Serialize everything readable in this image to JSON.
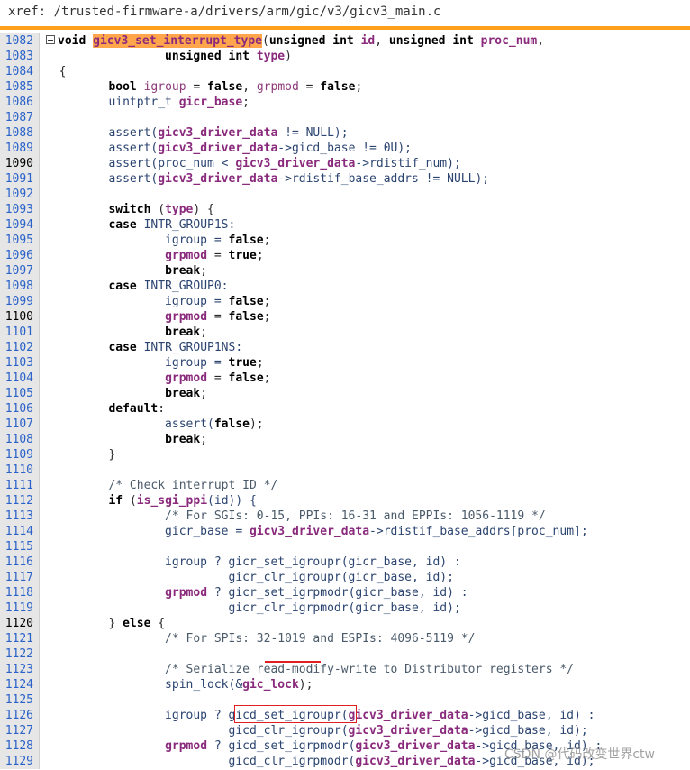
{
  "xref": {
    "path": "xref: /trusted-firmware-a/drivers/arm/gic/v3/gicv3_main.c"
  },
  "watermark": "CSDN @代码改变世界ctw",
  "colors": {
    "accent_bar": "#ff9f1a",
    "highlight": "#ffa64d",
    "annotation_red": "#e02020",
    "gutter": "#e6e6e6",
    "line_number": "#2a62c9"
  },
  "current_lines": [
    "1090",
    "1100",
    "1120"
  ],
  "lines": [
    {
      "num": "1082",
      "segs": [
        {
          "t": "void ",
          "c": "kw"
        },
        {
          "t": "gicv3_set_interrupt_type",
          "c": "hl"
        },
        {
          "t": "(",
          "c": "p"
        },
        {
          "t": "unsigned int ",
          "c": "kw"
        },
        {
          "t": "id",
          "c": "idb"
        },
        {
          "t": ", ",
          "c": "p"
        },
        {
          "t": "unsigned int ",
          "c": "kw"
        },
        {
          "t": "proc_num",
          "c": "idb"
        },
        {
          "t": ",",
          "c": "p"
        }
      ]
    },
    {
      "num": "1083",
      "segs": [
        {
          "t": "                 unsigned int ",
          "c": "kw"
        },
        {
          "t": "type",
          "c": "idb"
        },
        {
          "t": ")",
          "c": "p"
        }
      ]
    },
    {
      "num": "1084",
      "segs": [
        {
          "t": "  {",
          "c": "p"
        }
      ]
    },
    {
      "num": "1085",
      "segs": [
        {
          "t": "         ",
          "c": "p"
        },
        {
          "t": "bool ",
          "c": "kw"
        },
        {
          "t": "igroup",
          "c": "id"
        },
        {
          "t": " = ",
          "c": "p"
        },
        {
          "t": "false",
          "c": "kw"
        },
        {
          "t": ", ",
          "c": "p"
        },
        {
          "t": "grpmod",
          "c": "id"
        },
        {
          "t": " = ",
          "c": "p"
        },
        {
          "t": "false",
          "c": "kw"
        },
        {
          "t": ";",
          "c": "p"
        }
      ]
    },
    {
      "num": "1086",
      "segs": [
        {
          "t": "         uintptr_t ",
          "c": "plain"
        },
        {
          "t": "gicr_base",
          "c": "idb"
        },
        {
          "t": ";",
          "c": "p"
        }
      ]
    },
    {
      "num": "1087",
      "segs": []
    },
    {
      "num": "1088",
      "segs": [
        {
          "t": "         assert(",
          "c": "plain"
        },
        {
          "t": "gicv3_driver_data",
          "c": "idb"
        },
        {
          "t": " != NULL);",
          "c": "plain"
        }
      ]
    },
    {
      "num": "1089",
      "segs": [
        {
          "t": "         assert(",
          "c": "plain"
        },
        {
          "t": "gicv3_driver_data",
          "c": "idb"
        },
        {
          "t": "->gicd_base != 0U);",
          "c": "plain"
        }
      ]
    },
    {
      "num": "1090",
      "segs": [
        {
          "t": "         assert(proc_num < ",
          "c": "plain"
        },
        {
          "t": "gicv3_driver_data",
          "c": "idb"
        },
        {
          "t": "->rdistif_num);",
          "c": "plain"
        }
      ]
    },
    {
      "num": "1091",
      "segs": [
        {
          "t": "         assert(",
          "c": "plain"
        },
        {
          "t": "gicv3_driver_data",
          "c": "idb"
        },
        {
          "t": "->rdistif_base_addrs != NULL);",
          "c": "plain"
        }
      ]
    },
    {
      "num": "1092",
      "segs": []
    },
    {
      "num": "1093",
      "segs": [
        {
          "t": "         ",
          "c": "p"
        },
        {
          "t": "switch",
          "c": "kw"
        },
        {
          "t": " (",
          "c": "p"
        },
        {
          "t": "type",
          "c": "idb"
        },
        {
          "t": ") {",
          "c": "p"
        }
      ]
    },
    {
      "num": "1094",
      "segs": [
        {
          "t": "         ",
          "c": "p"
        },
        {
          "t": "case",
          "c": "kw"
        },
        {
          "t": " INTR_GROUP1S:",
          "c": "plain"
        }
      ]
    },
    {
      "num": "1095",
      "segs": [
        {
          "t": "                 igroup = ",
          "c": "plain"
        },
        {
          "t": "false",
          "c": "kw"
        },
        {
          "t": ";",
          "c": "p"
        }
      ]
    },
    {
      "num": "1096",
      "segs": [
        {
          "t": "                 ",
          "c": "p"
        },
        {
          "t": "grpmod",
          "c": "idb"
        },
        {
          "t": " = ",
          "c": "p"
        },
        {
          "t": "true",
          "c": "kw"
        },
        {
          "t": ";",
          "c": "p"
        }
      ]
    },
    {
      "num": "1097",
      "segs": [
        {
          "t": "                 ",
          "c": "p"
        },
        {
          "t": "break",
          "c": "kw"
        },
        {
          "t": ";",
          "c": "p"
        }
      ]
    },
    {
      "num": "1098",
      "segs": [
        {
          "t": "         ",
          "c": "p"
        },
        {
          "t": "case",
          "c": "kw"
        },
        {
          "t": " INTR_GROUP0:",
          "c": "plain"
        }
      ]
    },
    {
      "num": "1099",
      "segs": [
        {
          "t": "                 igroup = ",
          "c": "plain"
        },
        {
          "t": "false",
          "c": "kw"
        },
        {
          "t": ";",
          "c": "p"
        }
      ]
    },
    {
      "num": "1100",
      "segs": [
        {
          "t": "                 ",
          "c": "p"
        },
        {
          "t": "grpmod",
          "c": "idb"
        },
        {
          "t": " = ",
          "c": "p"
        },
        {
          "t": "false",
          "c": "kw"
        },
        {
          "t": ";",
          "c": "p"
        }
      ]
    },
    {
      "num": "1101",
      "segs": [
        {
          "t": "                 ",
          "c": "p"
        },
        {
          "t": "break",
          "c": "kw"
        },
        {
          "t": ";",
          "c": "p"
        }
      ]
    },
    {
      "num": "1102",
      "segs": [
        {
          "t": "         ",
          "c": "p"
        },
        {
          "t": "case",
          "c": "kw"
        },
        {
          "t": " INTR_GROUP1NS:",
          "c": "plain"
        }
      ]
    },
    {
      "num": "1103",
      "segs": [
        {
          "t": "                 igroup = ",
          "c": "plain"
        },
        {
          "t": "true",
          "c": "kw"
        },
        {
          "t": ";",
          "c": "p"
        }
      ]
    },
    {
      "num": "1104",
      "segs": [
        {
          "t": "                 ",
          "c": "p"
        },
        {
          "t": "grpmod",
          "c": "idb"
        },
        {
          "t": " = ",
          "c": "p"
        },
        {
          "t": "false",
          "c": "kw"
        },
        {
          "t": ";",
          "c": "p"
        }
      ]
    },
    {
      "num": "1105",
      "segs": [
        {
          "t": "                 ",
          "c": "p"
        },
        {
          "t": "break",
          "c": "kw"
        },
        {
          "t": ";",
          "c": "p"
        }
      ]
    },
    {
      "num": "1106",
      "segs": [
        {
          "t": "         ",
          "c": "p"
        },
        {
          "t": "default",
          "c": "kw"
        },
        {
          "t": ":",
          "c": "p"
        }
      ]
    },
    {
      "num": "1107",
      "segs": [
        {
          "t": "                 assert(",
          "c": "plain"
        },
        {
          "t": "false",
          "c": "kw"
        },
        {
          "t": ");",
          "c": "p"
        }
      ]
    },
    {
      "num": "1108",
      "segs": [
        {
          "t": "                 ",
          "c": "p"
        },
        {
          "t": "break",
          "c": "kw"
        },
        {
          "t": ";",
          "c": "p"
        }
      ]
    },
    {
      "num": "1109",
      "segs": [
        {
          "t": "         }",
          "c": "p"
        }
      ]
    },
    {
      "num": "1110",
      "segs": []
    },
    {
      "num": "1111",
      "segs": [
        {
          "t": "         /* Check interrupt ID */",
          "c": "cm"
        }
      ]
    },
    {
      "num": "1112",
      "segs": [
        {
          "t": "         ",
          "c": "p"
        },
        {
          "t": "if",
          "c": "kw"
        },
        {
          "t": " (",
          "c": "p"
        },
        {
          "t": "is_sgi_ppi",
          "c": "idb"
        },
        {
          "t": "(id)) {",
          "c": "plain"
        }
      ]
    },
    {
      "num": "1113",
      "segs": [
        {
          "t": "                 /* For SGIs: 0-15, PPIs: 16-31 and EPPIs: 1056-1119 */",
          "c": "cm"
        }
      ]
    },
    {
      "num": "1114",
      "segs": [
        {
          "t": "                 gicr_base = ",
          "c": "plain"
        },
        {
          "t": "gicv3_driver_data",
          "c": "idb"
        },
        {
          "t": "->rdistif_base_addrs[proc_num];",
          "c": "plain"
        }
      ]
    },
    {
      "num": "1115",
      "segs": []
    },
    {
      "num": "1116",
      "segs": [
        {
          "t": "                 igroup ? gicr_set_igroupr(gicr_base, id) :",
          "c": "plain"
        }
      ]
    },
    {
      "num": "1117",
      "segs": [
        {
          "t": "                          gicr_clr_igroupr(gicr_base, id);",
          "c": "plain"
        }
      ]
    },
    {
      "num": "1118",
      "segs": [
        {
          "t": "                 ",
          "c": "p"
        },
        {
          "t": "grpmod",
          "c": "idb"
        },
        {
          "t": " ? gicr_set_igrpmodr(gicr_base, id) :",
          "c": "plain"
        }
      ]
    },
    {
      "num": "1119",
      "segs": [
        {
          "t": "                          gicr_clr_igrpmodr(gicr_base, id);",
          "c": "plain"
        }
      ]
    },
    {
      "num": "1120",
      "segs": [
        {
          "t": "         } ",
          "c": "p"
        },
        {
          "t": "else",
          "c": "kw"
        },
        {
          "t": " {",
          "c": "p"
        }
      ]
    },
    {
      "num": "1121",
      "segs": [
        {
          "t": "                 /* For SPIs: 32-1019 and ESPIs: 4096-5119 */",
          "c": "cm"
        }
      ]
    },
    {
      "num": "1122",
      "segs": []
    },
    {
      "num": "1123",
      "segs": [
        {
          "t": "                 /* Serialize read-modify-write to Distributor registers */",
          "c": "cm"
        }
      ]
    },
    {
      "num": "1124",
      "segs": [
        {
          "t": "                 spin_lock(&",
          "c": "plain"
        },
        {
          "t": "gic_lock",
          "c": "idb"
        },
        {
          "t": ");",
          "c": "p"
        }
      ]
    },
    {
      "num": "1125",
      "segs": []
    },
    {
      "num": "1126",
      "segs": [
        {
          "t": "                 igroup ? gicd_set_igroupr(",
          "c": "plain"
        },
        {
          "t": "gicv3_driver_data",
          "c": "idb"
        },
        {
          "t": "->gicd_base, id) :",
          "c": "plain"
        }
      ]
    },
    {
      "num": "1127",
      "segs": [
        {
          "t": "                          gicd_clr_igroupr(",
          "c": "plain"
        },
        {
          "t": "gicv3_driver_data",
          "c": "idb"
        },
        {
          "t": "->gicd_base, id);",
          "c": "plain"
        }
      ]
    },
    {
      "num": "1128",
      "segs": [
        {
          "t": "                 ",
          "c": "p"
        },
        {
          "t": "grpmod",
          "c": "idb"
        },
        {
          "t": " ? gicd_set_igrpmodr(",
          "c": "plain"
        },
        {
          "t": "gicv3_driver_data",
          "c": "idb"
        },
        {
          "t": "->gicd_base, id) :",
          "c": "plain"
        }
      ]
    },
    {
      "num": "1129",
      "segs": [
        {
          "t": "                          gicd_clr_igrpmodr(",
          "c": "plain"
        },
        {
          "t": "gicv3_driver_data",
          "c": "idb"
        },
        {
          "t": "->gicd_base, id);",
          "c": "plain"
        }
      ]
    }
  ]
}
